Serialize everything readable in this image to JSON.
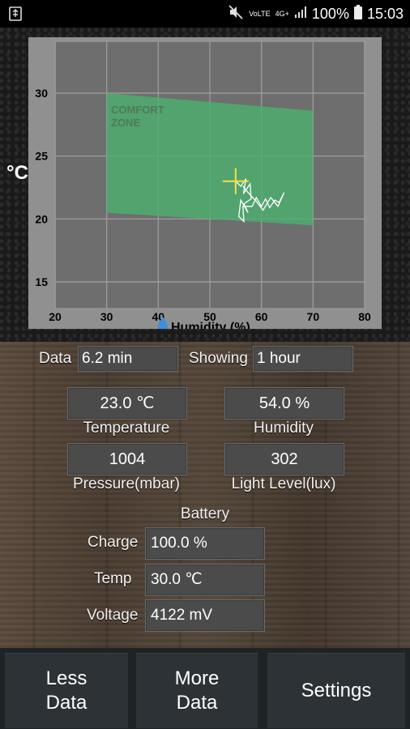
{
  "status_bar": {
    "battery": "100%",
    "time": "15:03",
    "network": "4G+",
    "volte": "VoLTE"
  },
  "chart_data": {
    "type": "scatter",
    "x": {
      "ticks": [
        "20",
        "30",
        "40",
        "50",
        "60",
        "70",
        "80"
      ],
      "range": [
        20,
        80
      ],
      "label": "Humidity (%)"
    },
    "y": {
      "ticks": [
        "15",
        "20",
        "25",
        "30"
      ],
      "range": [
        13,
        33
      ],
      "unit": "°C"
    },
    "zone_label": [
      "COMFORT",
      "ZONE"
    ],
    "zone_polygon": [
      [
        30,
        30
      ],
      [
        70,
        28.6
      ],
      [
        70,
        19.5
      ],
      [
        30,
        20.5
      ]
    ],
    "zone_color": "#4caf6e",
    "crosshair": {
      "x": 55,
      "y": 23,
      "color": "#f5e04a"
    },
    "trace": [
      [
        55,
        23
      ],
      [
        56,
        22.6
      ],
      [
        57,
        23.2
      ],
      [
        56.5,
        22
      ],
      [
        57.8,
        22.8
      ],
      [
        58,
        21.6
      ],
      [
        56.6,
        21.2
      ],
      [
        57.4,
        20.5
      ],
      [
        56,
        21.5
      ],
      [
        55.6,
        20.2
      ],
      [
        56.6,
        19.8
      ],
      [
        56.4,
        21
      ],
      [
        58.2,
        21
      ],
      [
        59,
        21.7
      ],
      [
        60,
        21
      ],
      [
        60.8,
        21.6
      ],
      [
        61.6,
        20.9
      ],
      [
        62.6,
        21.5
      ],
      [
        63.4,
        21.3
      ],
      [
        64.4,
        22.1
      ],
      [
        63.2,
        21
      ],
      [
        61.8,
        21.7
      ],
      [
        60.3,
        20.7
      ],
      [
        59,
        21.4
      ],
      [
        57.4,
        22.1
      ],
      [
        56.4,
        22.6
      ]
    ]
  },
  "controls": {
    "data_label": "Data",
    "data_value": "6.2 min",
    "showing_label": "Showing",
    "showing_value": "1 hour"
  },
  "readings": {
    "temperature": {
      "value": "23.0 ℃",
      "label": "Temperature"
    },
    "humidity": {
      "value": "54.0 %",
      "label": "Humidity"
    },
    "pressure": {
      "value": "1004",
      "label": "Pressure(mbar)"
    },
    "light": {
      "value": "302",
      "label": "Light  Level(lux)"
    }
  },
  "battery": {
    "title": "Battery",
    "charge_label": "Charge",
    "charge_value": "100.0 %",
    "temp_label": "Temp",
    "temp_value": "30.0 ℃",
    "voltage_label": "Voltage",
    "voltage_value": "4122 mV"
  },
  "buttons": {
    "less_data": [
      "Less",
      "Data"
    ],
    "more_data": [
      "More",
      "Data"
    ],
    "settings": "Settings"
  }
}
